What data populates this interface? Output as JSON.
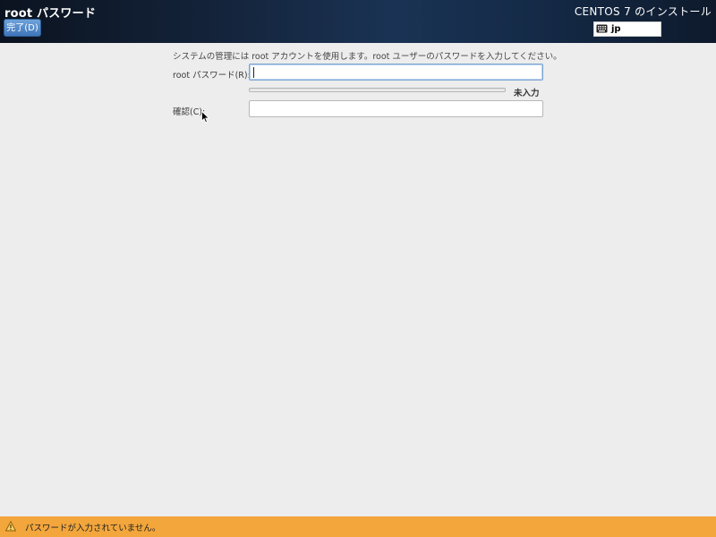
{
  "header": {
    "title": "root パスワード",
    "done_label": "完了(D)",
    "product_title": "CENTOS 7 のインストール",
    "keyboard_layout": "jp",
    "keyboard_icon": "keyboard-icon"
  },
  "form": {
    "intro": "システムの管理には root アカウントを使用します。root ユーザーのパスワードを入力してください。",
    "password_label": "root パスワード(R):",
    "password_value": "",
    "strength": {
      "label": "未入力",
      "fraction": 0
    },
    "confirm_label": "確認(C):",
    "confirm_value": ""
  },
  "warning": {
    "icon": "warning-icon",
    "text": "パスワードが入力されていません。",
    "color": "#f2a63c"
  },
  "colors": {
    "accent": "#4a80c4",
    "focus_border": "#7ea6d3",
    "background": "#ededed"
  }
}
